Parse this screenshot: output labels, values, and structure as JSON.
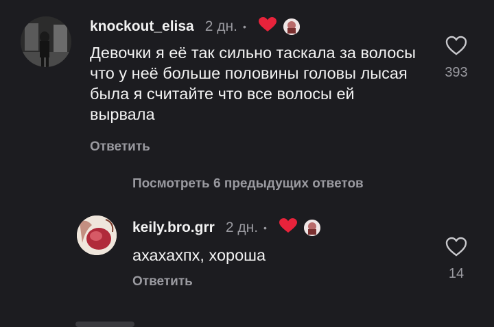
{
  "comments": [
    {
      "username": "knockout_elisa",
      "time": "2 дн.",
      "dot": "•",
      "text": "Девочки я её так сильно таскала за волосы что у неё больше половины головы лысая была я  считайте что все волосы ей вырвала",
      "reply_label": "Ответить",
      "like_count": "393"
    },
    {
      "username": "keily.bro.grr",
      "time": "2 дн.",
      "dot": "•",
      "text": "ахахахпх, хороша",
      "reply_label": "Ответить",
      "like_count": "14"
    }
  ],
  "view_replies_label": "Посмотреть 6 предыдущих ответов",
  "colors": {
    "background": "#1c1c20",
    "heart": "#e8233b",
    "muted": "#9a9aa0"
  },
  "icons": [
    "heart-icon",
    "creator-avatar-badge",
    "like-outline-icon"
  ]
}
